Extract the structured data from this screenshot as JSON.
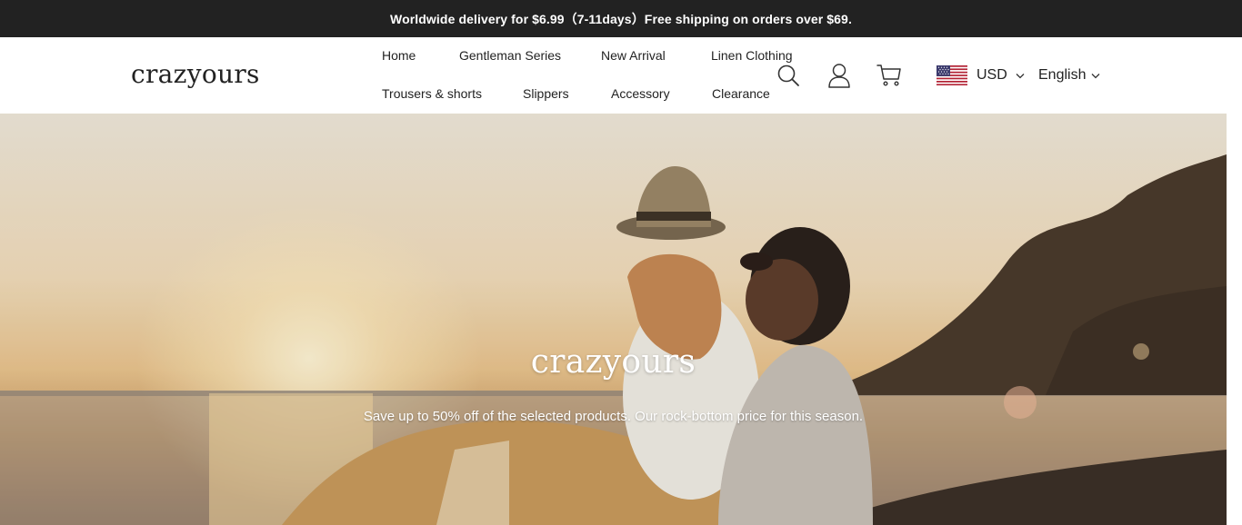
{
  "announcement": {
    "text": "Worldwide delivery for $6.99（7-11days）Free shipping on orders over $69."
  },
  "header": {
    "logo": "crazyours",
    "nav_row1": [
      "Home",
      "Gentleman Series",
      "New Arrival",
      "Linen Clothing"
    ],
    "nav_row2": [
      "Trousers & shorts",
      "Slippers",
      "Accessory",
      "Clearance"
    ],
    "icons": [
      "search-icon",
      "account-icon",
      "cart-icon"
    ],
    "currency": {
      "code": "USD",
      "flag": "us-flag-icon"
    },
    "language": "English"
  },
  "hero": {
    "title": "crazyours",
    "subtitle": "Save up to 50% off of the selected products. Our rock-bottom price for this season."
  },
  "colors": {
    "announcement_bg": "#222222",
    "text": "#222222",
    "hero_text": "#ffffff"
  }
}
